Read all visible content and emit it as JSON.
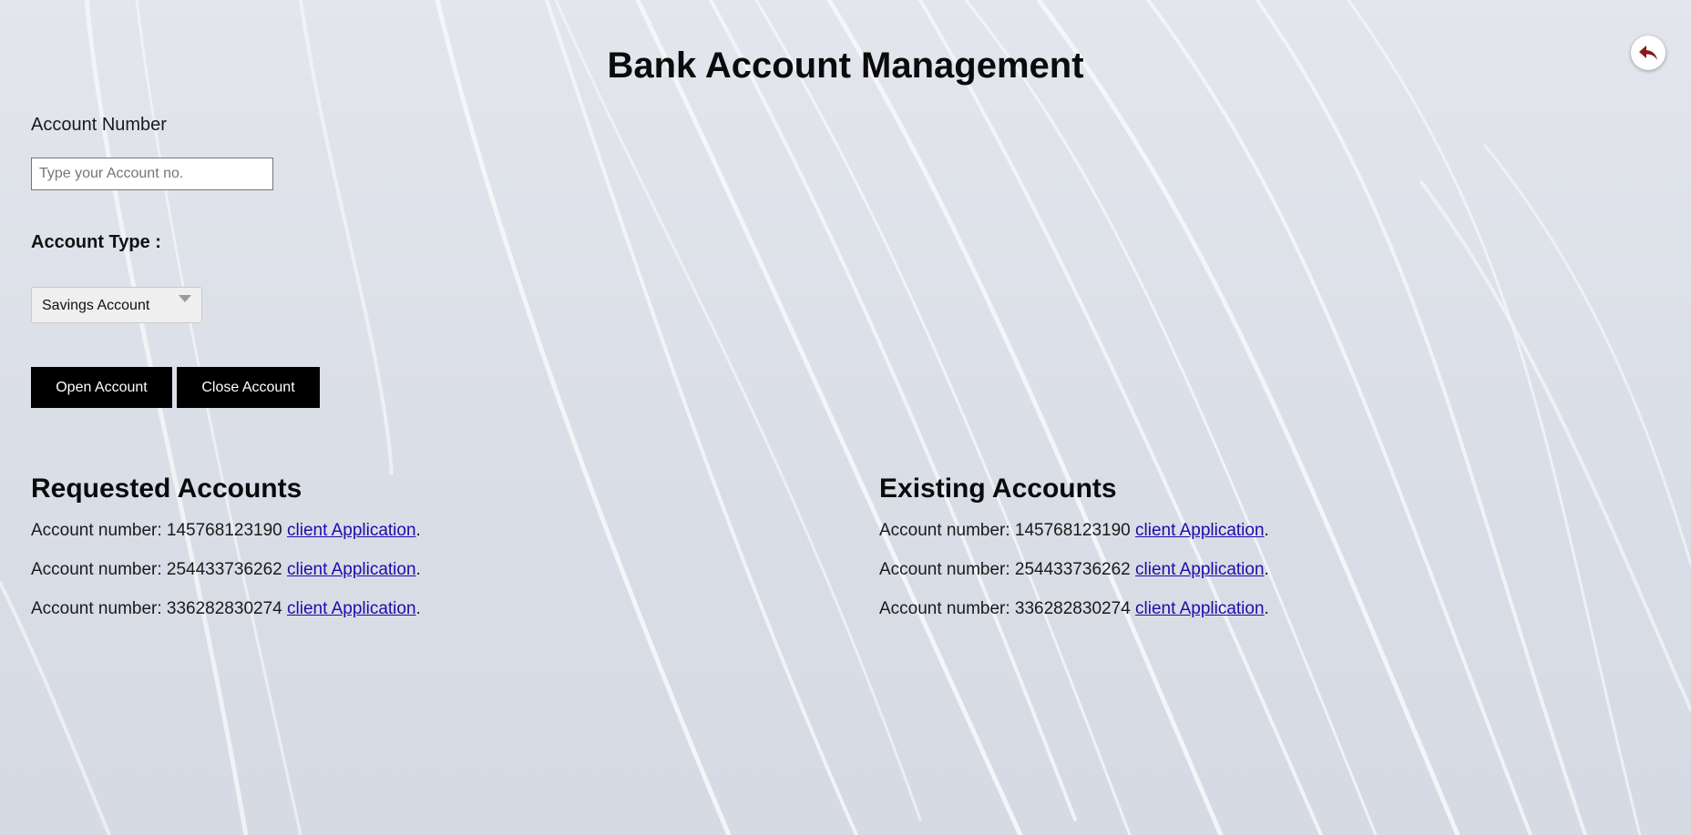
{
  "page_title": "Bank Account Management",
  "back_button": {
    "icon": "reply-arrow-icon",
    "color": "#8b1a1a"
  },
  "account_number": {
    "label": "Account Number",
    "placeholder": "Type your Account no.",
    "value": ""
  },
  "account_type": {
    "label": "Account Type :",
    "selected": "Savings Account"
  },
  "actions": {
    "open_label": "Open Account",
    "close_label": "Close Account"
  },
  "requested_accounts": {
    "title": "Requested Accounts",
    "items": [
      {
        "prefix": "Account number: 145768123190",
        "link": "client Application",
        "suffix": "."
      },
      {
        "prefix": "Account number: 254433736262",
        "link": "client Application",
        "suffix": "."
      },
      {
        "prefix": "Account number: 336282830274",
        "link": "client Application",
        "suffix": "."
      }
    ]
  },
  "existing_accounts": {
    "title": "Existing Accounts",
    "items": [
      {
        "prefix": "Account number: 145768123190",
        "link": "client Application",
        "suffix": "."
      },
      {
        "prefix": "Account number: 254433736262",
        "link": "client Application",
        "suffix": "."
      },
      {
        "prefix": "Account number: 336282830274",
        "link": "client Application",
        "suffix": "."
      }
    ]
  },
  "colors": {
    "background": "#dde1e8",
    "button": "#000000",
    "link": "#1a0dab"
  }
}
